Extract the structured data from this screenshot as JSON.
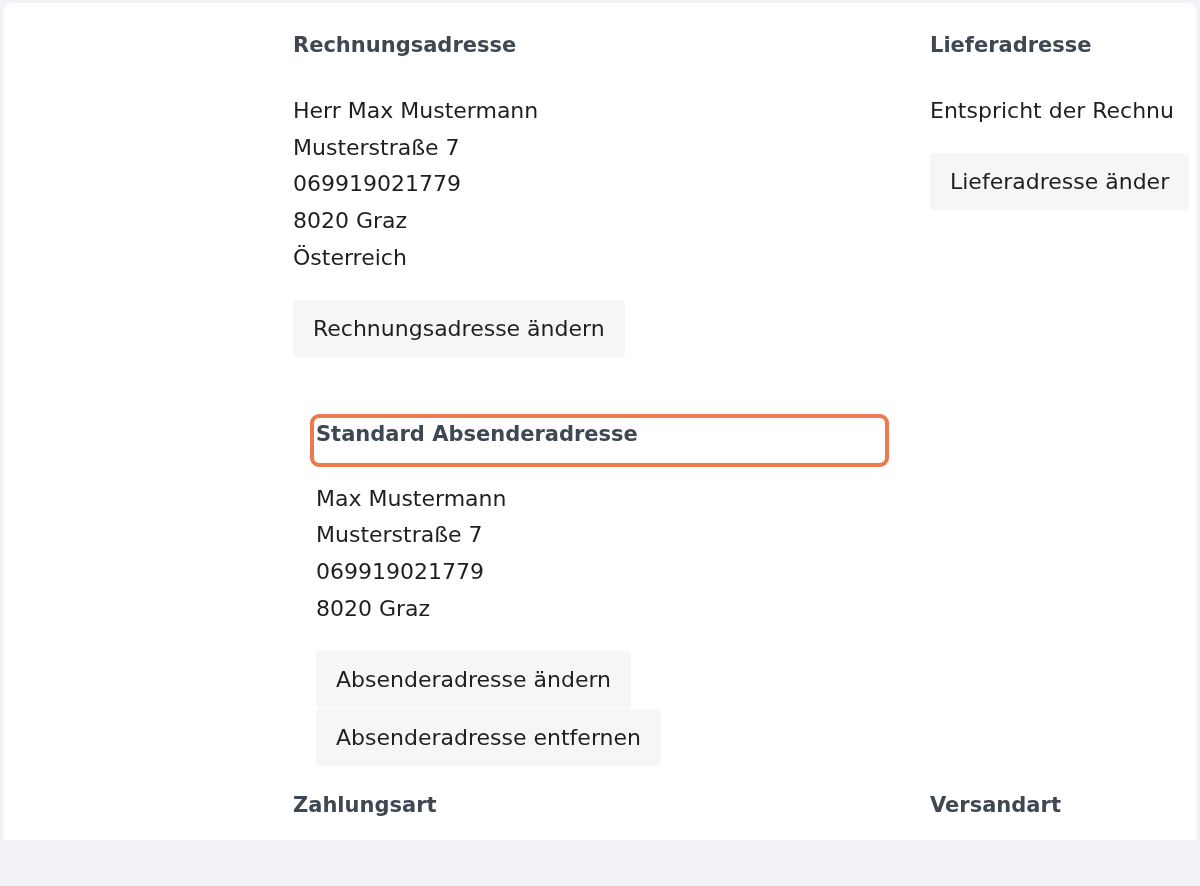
{
  "address_columns": [
    {
      "heading": "Rechnungsadresse",
      "lines": [
        "Herr Max Mustermann",
        "Musterstraße 7",
        "069919021779",
        "8020 Graz",
        "Österreich"
      ],
      "button": "Rechnungsadresse ändern"
    },
    {
      "heading": "Lieferadresse",
      "lines": [
        "Entspricht der Rechnu"
      ],
      "button": "Lieferadresse änder"
    }
  ],
  "sender": {
    "heading": "Standard Absenderadresse",
    "highlighted": true,
    "lines": [
      "Max Mustermann",
      "Musterstraße 7",
      "069919021779",
      "8020 Graz"
    ],
    "buttons": [
      "Absenderadresse ändern",
      "Absenderadresse entfernen"
    ]
  },
  "bottom_headings": [
    "Zahlungsart",
    "Versandart"
  ]
}
